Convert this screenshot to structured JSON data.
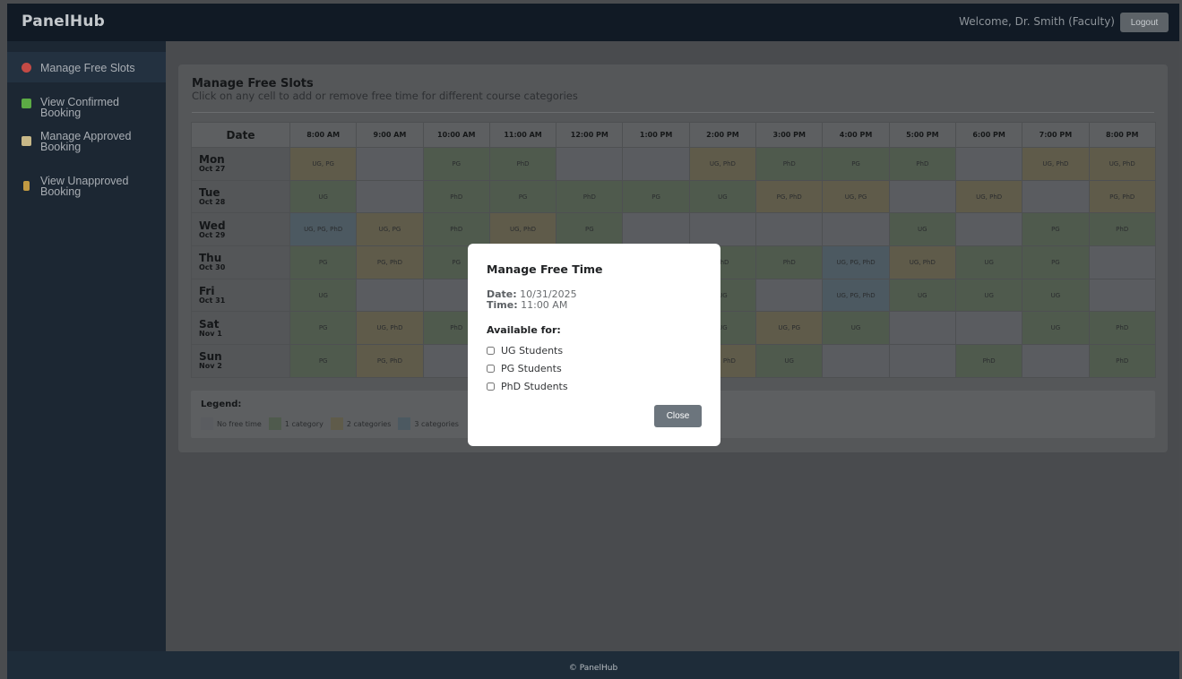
{
  "header": {
    "brand": "PanelHub",
    "welcome": "Welcome, Dr. Smith (Faculty)",
    "logout_label": "Logout"
  },
  "sidebar": {
    "items": [
      {
        "label": "Manage Free Slots",
        "icon": "alarm-clock-icon",
        "icon_color": "#d9534f",
        "active": true
      },
      {
        "label": "View Confirmed Booking",
        "icon": "check-box-icon",
        "icon_color": "#5cb85c"
      },
      {
        "label": "Manage Approved Booking",
        "icon": "memo-icon",
        "icon_color": "#e0c070"
      },
      {
        "label": "View Unapproved Booking",
        "icon": "hourglass-icon",
        "icon_color": "#d4a94a"
      }
    ]
  },
  "page": {
    "title": "Manage Free Slots",
    "subtitle": "Click on any cell to add or remove free time for different course categories"
  },
  "schedule": {
    "date_header": "Date",
    "times": [
      "8:00 AM",
      "9:00 AM",
      "10:00 AM",
      "11:00 AM",
      "12:00 PM",
      "1:00 PM",
      "2:00 PM",
      "3:00 PM",
      "4:00 PM",
      "5:00 PM",
      "6:00 PM",
      "7:00 PM",
      "8:00 PM"
    ],
    "rows": [
      {
        "day": "Mon",
        "date": "Oct 27",
        "cells": [
          "UG, PG",
          "",
          "PG",
          "PhD",
          "",
          "",
          "UG, PhD",
          "PhD",
          "PG",
          "PhD",
          "",
          "UG, PhD",
          "UG, PhD"
        ]
      },
      {
        "day": "Tue",
        "date": "Oct 28",
        "cells": [
          "UG",
          "",
          "PhD",
          "PG",
          "PhD",
          "PG",
          "UG",
          "PG, PhD",
          "UG, PG",
          "",
          "UG, PhD",
          "",
          "PG, PhD"
        ]
      },
      {
        "day": "Wed",
        "date": "Oct 29",
        "cells": [
          "UG, PG, PhD",
          "UG, PG",
          "PhD",
          "UG, PhD",
          "PG",
          "",
          "",
          "",
          "",
          "UG",
          "",
          "PG",
          "PhD"
        ]
      },
      {
        "day": "Thu",
        "date": "Oct 30",
        "cells": [
          "PG",
          "PG, PhD",
          "PG",
          "",
          "",
          "",
          "PhD",
          "PhD",
          "UG, PG, PhD",
          "UG, PhD",
          "UG",
          "PG",
          ""
        ]
      },
      {
        "day": "Fri",
        "date": "Oct 31",
        "cells": [
          "UG",
          "",
          "",
          "",
          "",
          "",
          "UG",
          "",
          "UG, PG, PhD",
          "UG",
          "UG",
          "UG",
          ""
        ]
      },
      {
        "day": "Sat",
        "date": "Nov 1",
        "cells": [
          "PG",
          "UG, PhD",
          "PhD",
          "",
          "",
          "",
          "UG",
          "UG, PG",
          "UG",
          "",
          "",
          "UG",
          "PhD"
        ]
      },
      {
        "day": "Sun",
        "date": "Nov 2",
        "cells": [
          "PG",
          "PG, PhD",
          "",
          "",
          "",
          "",
          "UG, PhD",
          "UG",
          "",
          "",
          "PhD",
          "",
          "PhD"
        ]
      }
    ]
  },
  "legend": {
    "title": "Legend:",
    "items": [
      {
        "label": "No free time",
        "color": "#5a5c60"
      },
      {
        "label": "1 category",
        "color": "#4f5a4d"
      },
      {
        "label": "2 categories",
        "color": "#5f5b4a"
      },
      {
        "label": "3 categories",
        "color": "#4c5961"
      }
    ]
  },
  "modal": {
    "title": "Manage Free Time",
    "date_label": "Date:",
    "date_value": "10/31/2025",
    "time_label": "Time:",
    "time_value": "11:00 AM",
    "available_label": "Available for:",
    "options": [
      "UG Students",
      "PG Students",
      "PhD Students"
    ],
    "close_label": "Close"
  },
  "footer": {
    "text": "© PanelHub"
  }
}
